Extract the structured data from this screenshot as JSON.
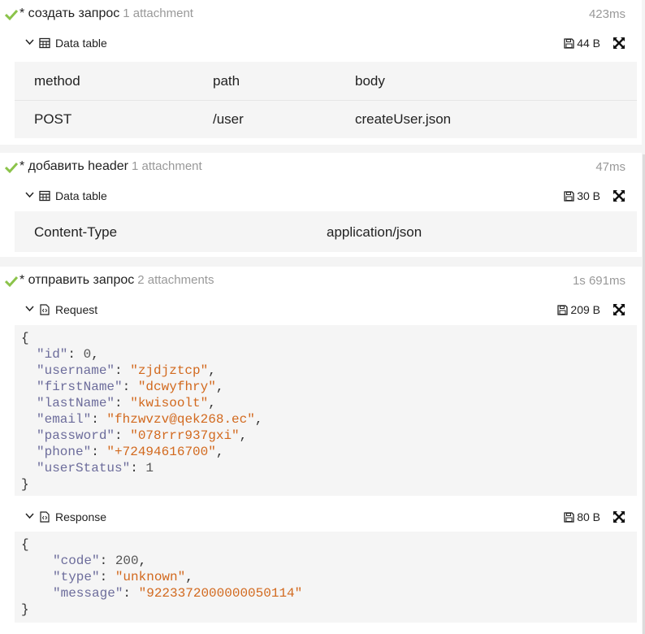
{
  "colors": {
    "check": "#8bc34a",
    "string": "#d2691e",
    "key": "#6c6c9b"
  },
  "steps": [
    {
      "title": "* создать запрос",
      "attachments": "1 attachment",
      "time": "423ms",
      "attachment": {
        "title": "Data table",
        "size": "44 B",
        "table": [
          [
            "method",
            "path",
            "body"
          ],
          [
            "POST",
            "/user",
            "createUser.json"
          ]
        ]
      }
    },
    {
      "title": "* добавить header",
      "attachments": "1 attachment",
      "time": "47ms",
      "attachment": {
        "title": "Data table",
        "size": "30 B",
        "table": [
          [
            "Content-Type",
            "application/json"
          ]
        ]
      }
    },
    {
      "title": "* отправить запрос",
      "attachments": "2 attachments",
      "time": "1s 691ms",
      "request": {
        "title": "Request",
        "size": "209 B",
        "open": "{",
        "close": "}",
        "fields": [
          {
            "key": "\"id\"",
            "value": "0",
            "type": "n",
            "comma": ","
          },
          {
            "key": "\"username\"",
            "value": "\"zjdjztcp\"",
            "type": "s",
            "comma": ","
          },
          {
            "key": "\"firstName\"",
            "value": "\"dcwyfhry\"",
            "type": "s",
            "comma": ","
          },
          {
            "key": "\"lastName\"",
            "value": "\"kwisoolt\"",
            "type": "s",
            "comma": ","
          },
          {
            "key": "\"email\"",
            "value": "\"fhzwvzv@qek268.ec\"",
            "type": "s",
            "comma": ","
          },
          {
            "key": "\"password\"",
            "value": "\"078rrr937gxi\"",
            "type": "s",
            "comma": ","
          },
          {
            "key": "\"phone\"",
            "value": "\"+72494616700\"",
            "type": "s",
            "comma": ","
          },
          {
            "key": "\"userStatus\"",
            "value": "1",
            "type": "n",
            "comma": ""
          }
        ]
      },
      "response": {
        "title": "Response",
        "size": "80 B",
        "open": "{",
        "close": "}",
        "fields": [
          {
            "key": "\"code\"",
            "value": "200",
            "type": "n",
            "comma": ","
          },
          {
            "key": "\"type\"",
            "value": "\"unknown\"",
            "type": "s",
            "comma": ","
          },
          {
            "key": "\"message\"",
            "value": "\"9223372000000050114\"",
            "type": "s",
            "comma": ""
          }
        ]
      }
    }
  ]
}
